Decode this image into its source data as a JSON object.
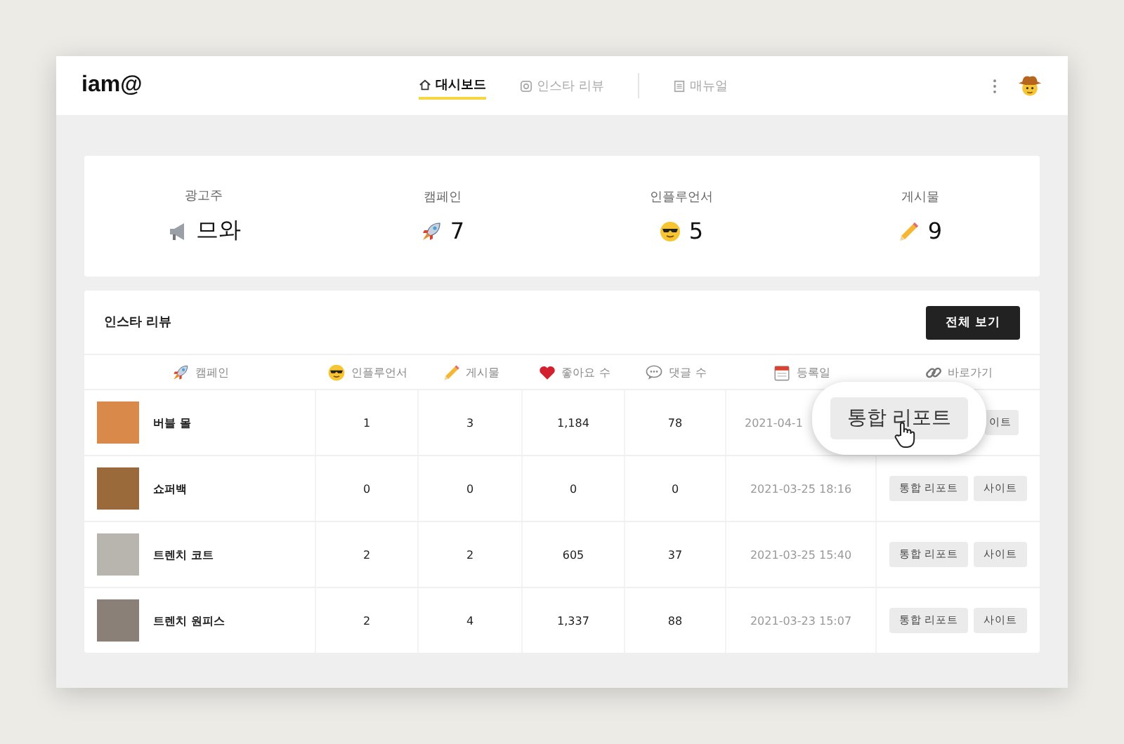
{
  "header": {
    "logo": "iam@",
    "nav": [
      {
        "label": "대시보드",
        "selected": true
      },
      {
        "label": "인스타 리뷰",
        "selected": false
      },
      {
        "label": "매뉴얼",
        "selected": false
      }
    ]
  },
  "stats": [
    {
      "label": "광고주",
      "value": "므와"
    },
    {
      "label": "캠페인",
      "value": "7"
    },
    {
      "label": "인플루언서",
      "value": "5"
    },
    {
      "label": "게시물",
      "value": "9"
    }
  ],
  "review": {
    "title": "인스타 리뷰",
    "view_all": "전체 보기",
    "columns": [
      "캠페인",
      "인플루언서",
      "게시물",
      "좋아요 수",
      "댓글 수",
      "등록일",
      "바로가기"
    ],
    "rows": [
      {
        "name": "버블 몰",
        "influencers": "1",
        "posts": "3",
        "likes": "1,184",
        "comments": "78",
        "date": "2021-04-1",
        "site": "이트"
      },
      {
        "name": "쇼퍼백",
        "influencers": "0",
        "posts": "0",
        "likes": "0",
        "comments": "0",
        "date": "2021-03-25 18:16",
        "report": "통합 리포트",
        "site": "사이트"
      },
      {
        "name": "트렌치 코트",
        "influencers": "2",
        "posts": "2",
        "likes": "605",
        "comments": "37",
        "date": "2021-03-25 15:40",
        "report": "통합 리포트",
        "site": "사이트"
      },
      {
        "name": "트렌치 원피스",
        "influencers": "2",
        "posts": "4",
        "likes": "1,337",
        "comments": "88",
        "date": "2021-03-23 15:07",
        "report": "통합 리포트",
        "site": "사이트"
      }
    ],
    "magnifier": {
      "label": "통합 리포트"
    }
  }
}
